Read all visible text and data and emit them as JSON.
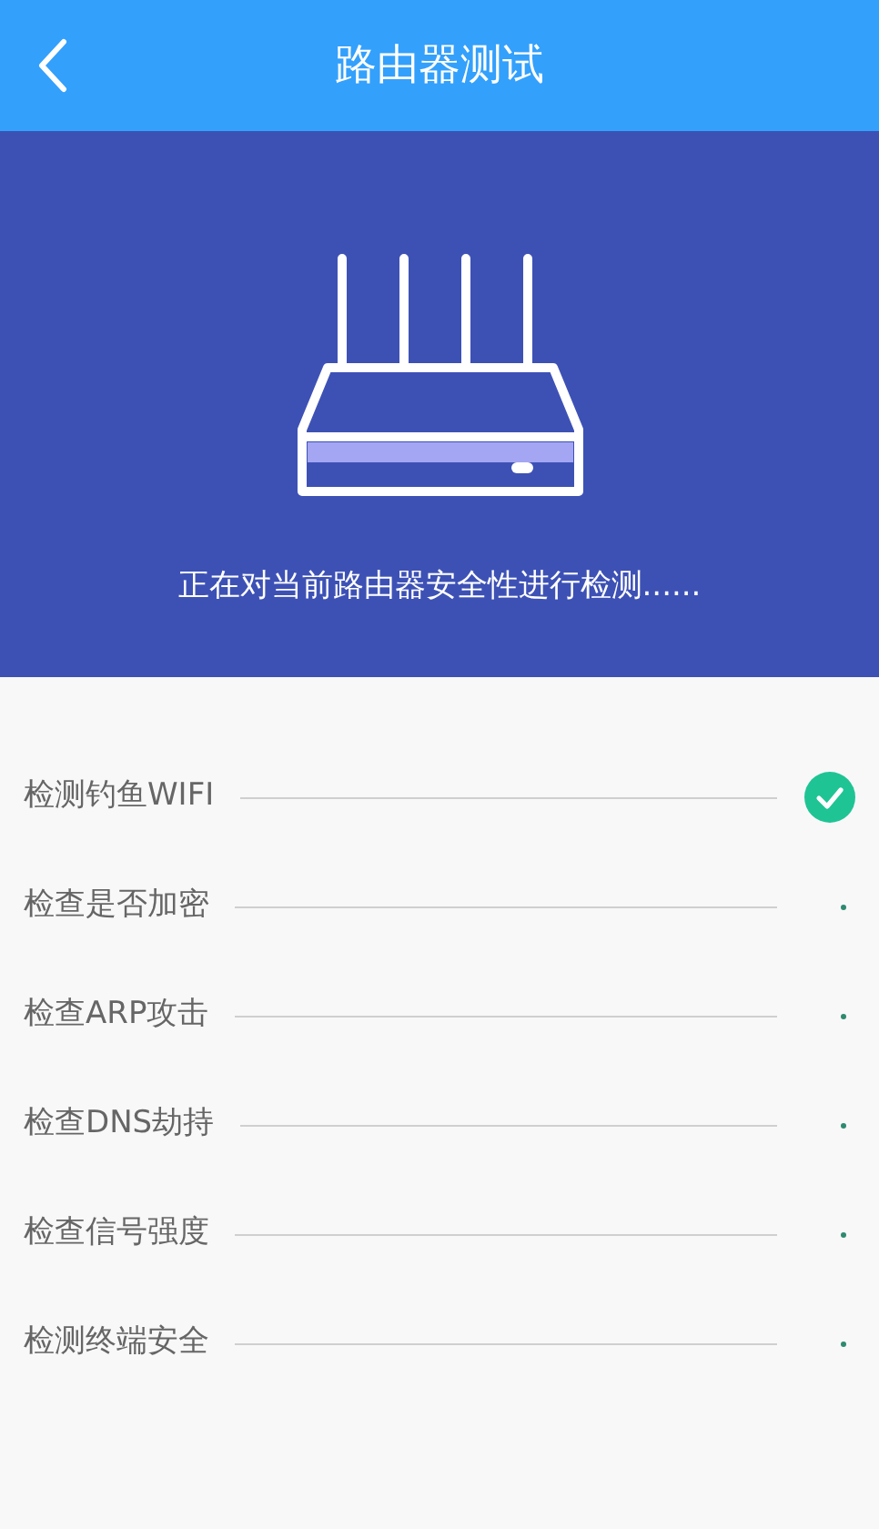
{
  "header": {
    "title": "路由器测试"
  },
  "banner": {
    "status_text": "正在对当前路由器安全性进行检测......"
  },
  "checks": [
    {
      "label": "检测钓鱼WIFI",
      "done": true
    },
    {
      "label": "检查是否加密",
      "done": false
    },
    {
      "label": "检查ARP攻击",
      "done": false
    },
    {
      "label": "检查DNS劫持",
      "done": false
    },
    {
      "label": "检查信号强度",
      "done": false
    },
    {
      "label": "检测终端安全",
      "done": false
    }
  ]
}
